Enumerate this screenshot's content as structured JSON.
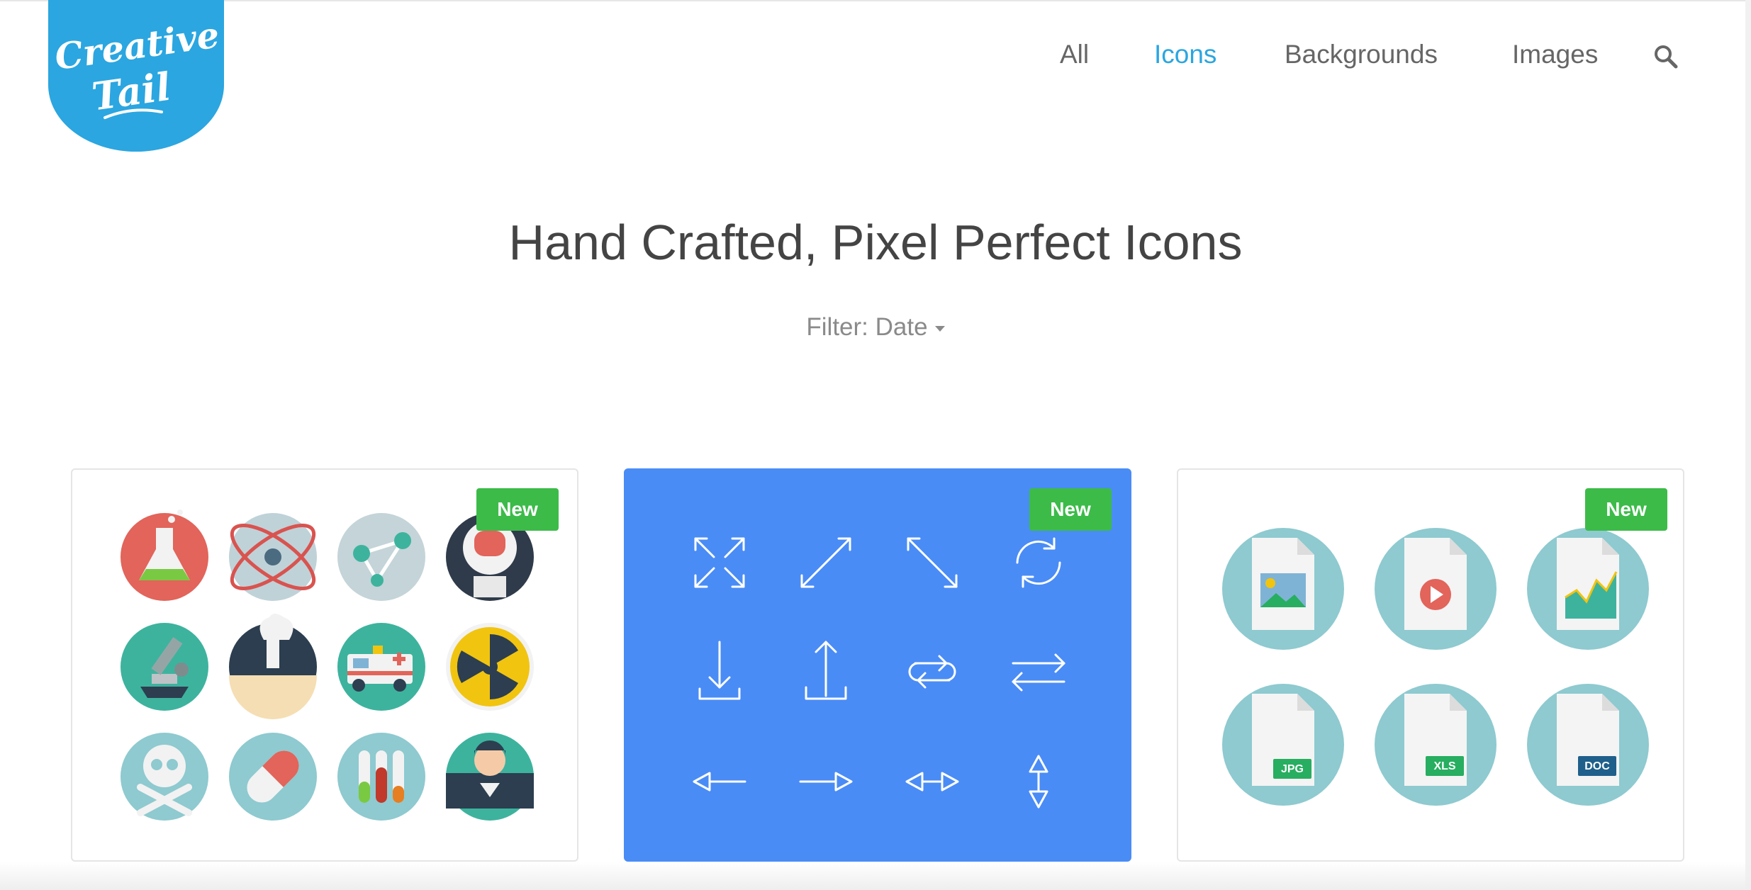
{
  "brand": {
    "logo_text_line1": "Creative",
    "logo_text_line2": "Tail",
    "color": "#2ba6e0"
  },
  "nav": {
    "items": [
      {
        "label": "All",
        "active": false
      },
      {
        "label": "Icons",
        "active": true
      },
      {
        "label": "Backgrounds",
        "active": false
      },
      {
        "label": "Images",
        "active": false
      }
    ],
    "search_icon": "search-icon",
    "active_color": "#2ba6e0"
  },
  "hero": {
    "title": "Hand Crafted, Pixel Perfect Icons"
  },
  "filter": {
    "label": "Filter:",
    "value": "Date"
  },
  "cards": [
    {
      "badge": "New",
      "theme": "science-flat-icons",
      "background": "#ffffff"
    },
    {
      "badge": "New",
      "theme": "line-arrow-icons",
      "background": "#4a8cf6"
    },
    {
      "badge": "New",
      "theme": "file-type-icons",
      "background": "#ffffff",
      "file_labels": [
        "JPG",
        "XLS",
        "DOC"
      ]
    }
  ],
  "colors": {
    "badge": "#3cbb49",
    "card_blue": "#4a8cf6"
  }
}
